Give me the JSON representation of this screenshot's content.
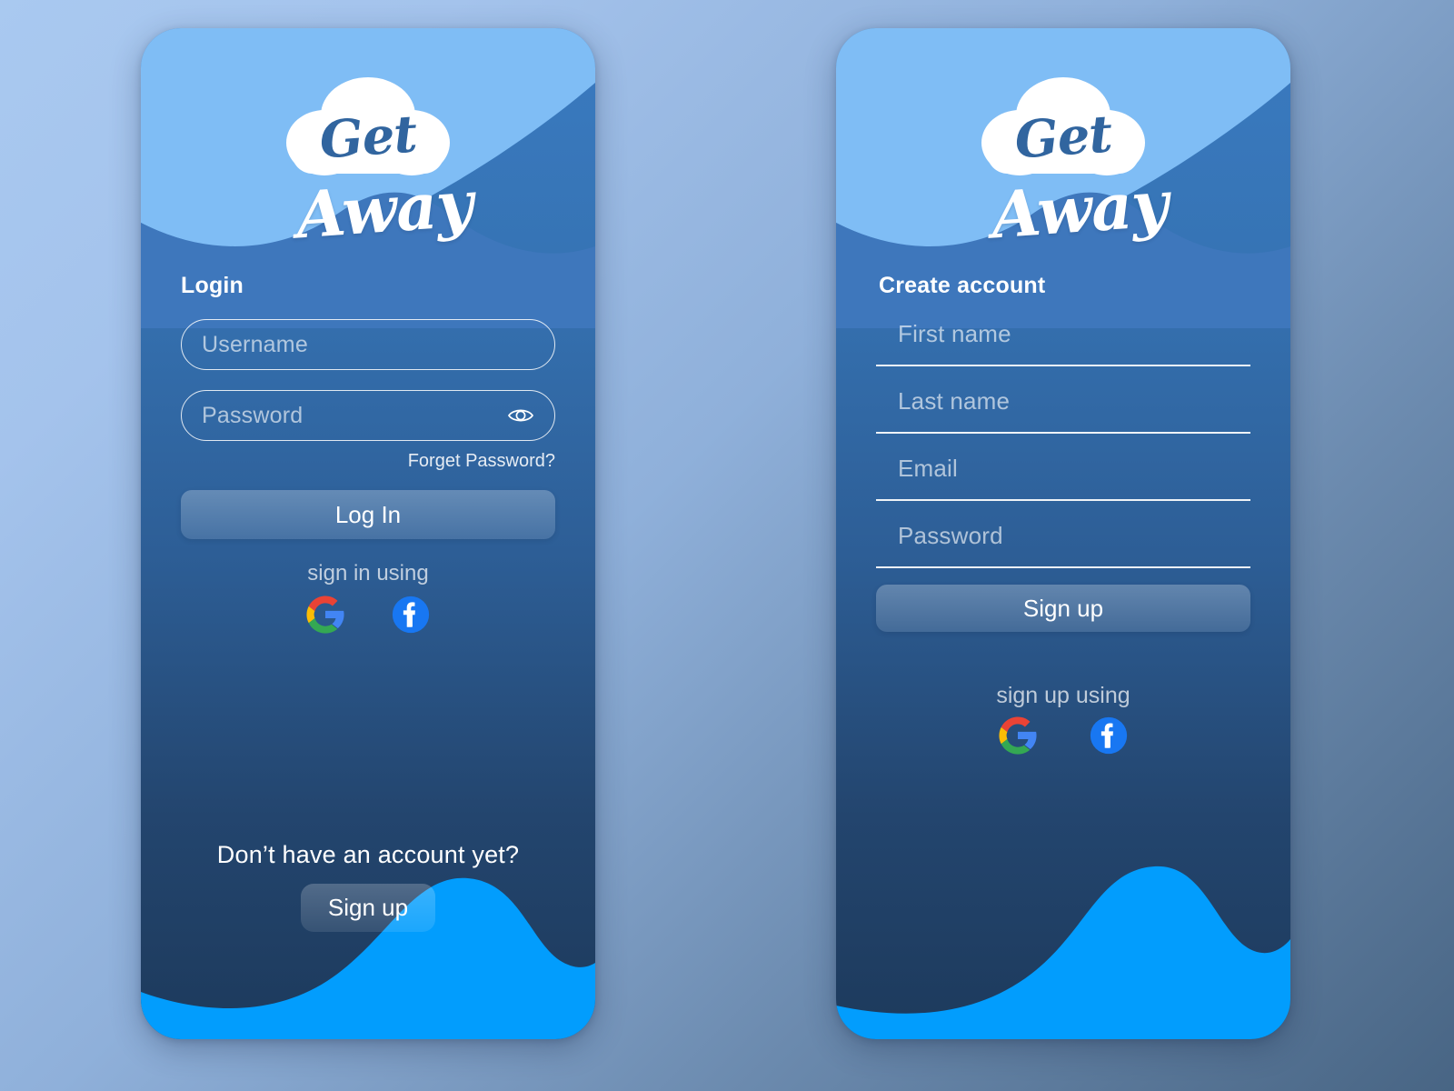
{
  "theme": {
    "page_bg_from": "#a9c9f0",
    "page_bg_to": "#486584",
    "card_top": "#3a7ac0",
    "card_bottom": "#1d3a5c",
    "sky_wave": "#7fbdf5",
    "mid_wave": "#3e77bc",
    "bottom_wave": "#029dfd",
    "logo_text": "#31659f",
    "accent_white": "#ffffff"
  },
  "brand": {
    "name_line1": "Get",
    "name_line2": "Away",
    "cloud_icon": "cloud-icon"
  },
  "login_card": {
    "title": "Login",
    "fields": [
      {
        "name": "username",
        "placeholder": "Username",
        "value": "",
        "type": "text",
        "has_toggle": false
      },
      {
        "name": "password",
        "placeholder": "Password",
        "value": "",
        "type": "password",
        "has_toggle": true,
        "toggle_icon": "eye-icon"
      }
    ],
    "forgot_password_link": "Forget Password?",
    "submit_label": "Log In",
    "social_prompt": "sign in using",
    "socials": [
      {
        "name": "google",
        "icon": "google-icon"
      },
      {
        "name": "facebook",
        "icon": "facebook-icon"
      }
    ],
    "footer_question": "Don’t have an account yet?",
    "footer_action": "Sign up"
  },
  "signup_card": {
    "title": "Create account",
    "fields": [
      {
        "name": "first_name",
        "placeholder": "First name",
        "value": "",
        "type": "text"
      },
      {
        "name": "last_name",
        "placeholder": "Last name",
        "value": "",
        "type": "text"
      },
      {
        "name": "email",
        "placeholder": "Email",
        "value": "",
        "type": "email"
      },
      {
        "name": "password",
        "placeholder": "Password",
        "value": "",
        "type": "password"
      }
    ],
    "submit_label": "Sign up",
    "social_prompt": "sign up using",
    "socials": [
      {
        "name": "google",
        "icon": "google-icon"
      },
      {
        "name": "facebook",
        "icon": "facebook-icon"
      }
    ]
  }
}
